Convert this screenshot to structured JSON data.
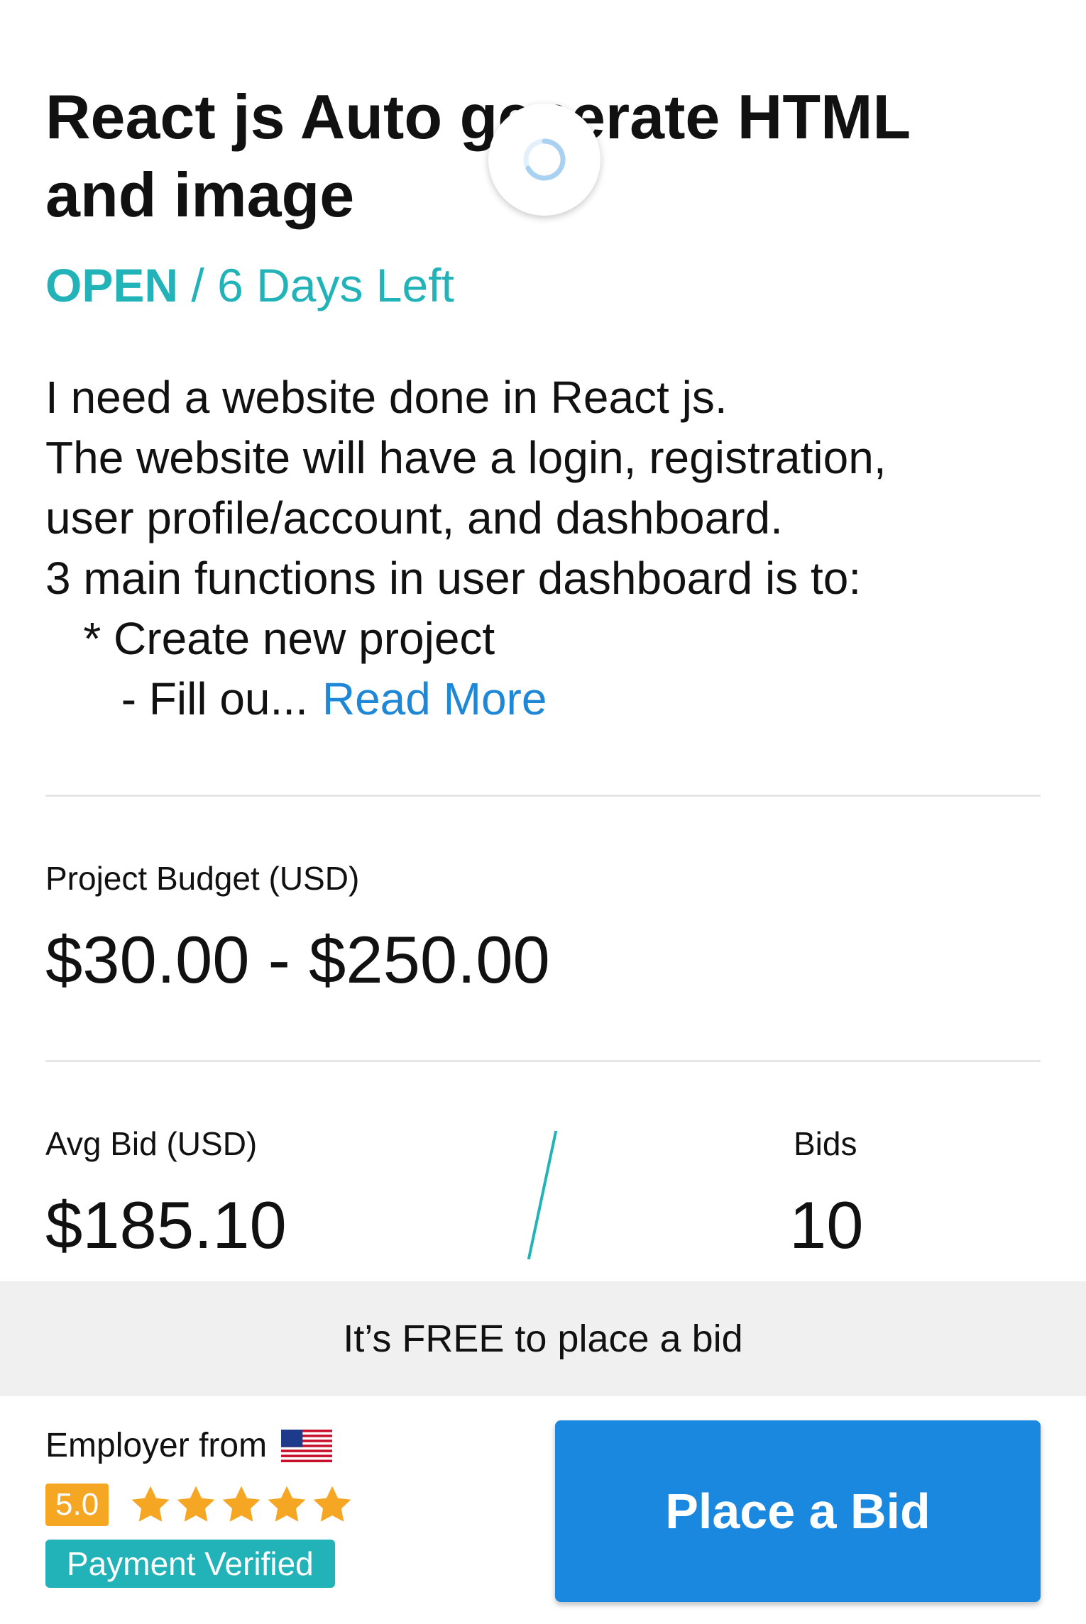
{
  "project": {
    "title_line1": "React js Auto generate HTML",
    "title_line2": "and image",
    "status": "OPEN",
    "separator": " / ",
    "time_left": "6 Days Left",
    "description_lines": [
      "I need a website done in React js.",
      "The website will have a login, registration,",
      "user profile/account, and dashboard.",
      "3 main functions in user dashboard is to:",
      "   * Create new project",
      "      - Fill ou..."
    ],
    "read_more": "Read More"
  },
  "budget": {
    "label": "Project Budget (USD)",
    "value": "$30.00 - $250.00"
  },
  "stats": {
    "avg_bid_label": "Avg Bid (USD)",
    "avg_bid_value": "$185.10",
    "bids_label": "Bids",
    "bids_value": "10"
  },
  "banner": {
    "text": "It’s FREE to place a bid"
  },
  "employer": {
    "from_label": "Employer from",
    "country_flag_icon": "us-flag-icon",
    "rating": "5.0",
    "stars": 5,
    "payment_verified": "Payment Verified"
  },
  "actions": {
    "place_bid": "Place a Bid"
  },
  "colors": {
    "accent_teal": "#22b3b8",
    "link_blue": "#1e88d6",
    "button_blue": "#1b88e0",
    "rating_orange": "#f5a623"
  }
}
